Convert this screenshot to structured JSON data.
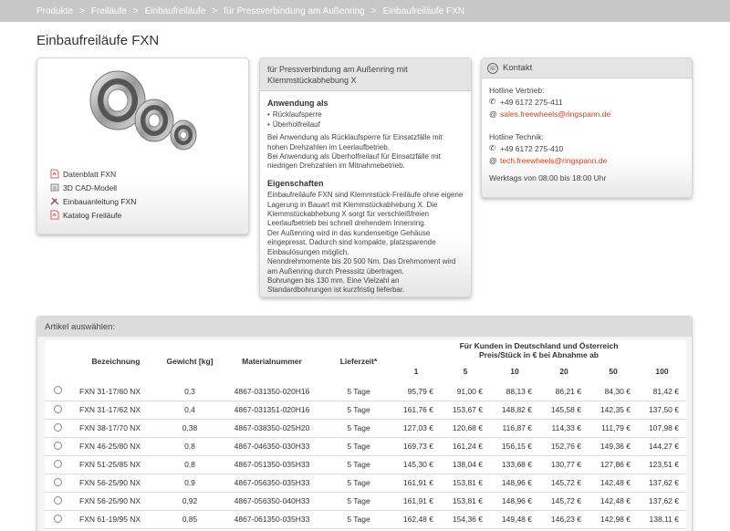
{
  "breadcrumb": [
    "Produkte",
    "Freiläufe",
    "Einbaufreiläufe",
    "für Pressverbindung am Außenring",
    "Einbaufreiläufe FXN"
  ],
  "page_title": "Einbaufreiläufe FXN",
  "downloads": [
    {
      "label": "Datenblatt FXN",
      "icon": "pdf-icon"
    },
    {
      "label": "3D CAD-Modell",
      "icon": "cad-icon"
    },
    {
      "label": "Einbauanleitung FXN",
      "icon": "tools-icon"
    },
    {
      "label": "Katalog Freiläufe",
      "icon": "pdf-icon"
    }
  ],
  "description": {
    "header": "für Pressverbindung am Außenring mit Klemmstückabhebung X",
    "usage_title": "Anwendung als",
    "usage_items": [
      "Rücklaufsperre",
      "Überholfreilauf"
    ],
    "usage_text_1": "Bei Anwendung als Rücklaufsperre für Einsatzfälle mit hohen Drehzahlen im Leerlaufbetrieb.",
    "usage_text_2": "Bei Anwendung als Überholfreilauf für Einsatzfälle mit niedrigen Drehzahlen im Mitnahmebetrieb.",
    "props_title": "Eigenschaften",
    "props_lines": [
      "Einbaufreiläufe FXN sind Klemmstück-Freiläufe ohne eigene Lagerung in Bauart mit Klemmstückabhebung X. Die Klemmstückabhebung X sorgt für verschleißfreien Leerlaufbetrieb bei schnell drehendem Innenring.",
      "Der Außenring wird in das kundenseitige Gehäuse eingepresst. Dadurch sind kompakte, platzsparende Einbaulösungen möglich.",
      "Nenndrehmomente bis 20 500 Nm. Das Drehmoment wird am Außenring durch Presssitz übertragen.",
      "Bohrungen bis 130 mm. Eine Vielzahl an Standardbohrungen ist kurzfristig lieferbar."
    ]
  },
  "contact": {
    "title": "Kontakt",
    "sales_label": "Hotline Vertrieb:",
    "sales_phone": "+49 6172 275-411",
    "sales_mail": "sales.freewheels@ringspann.de",
    "tech_label": "Hotline Technik:",
    "tech_phone": "+49 6172 275-410",
    "tech_mail": "tech.freewheels@ringspann.de",
    "hours": "Werktags von 08:00 bis 18:00 Uhr"
  },
  "table": {
    "section_title": "Artikel auswählen:",
    "col_name": "Bezeichnung",
    "col_weight": "Gewicht [kg]",
    "col_material": "Materialnummer",
    "col_delivery": "Lieferzeit*",
    "price_header_1": "Für Kunden in Deutschland und Österreich",
    "price_header_2": "Preis/Stück in € bei Abnahme ab",
    "quantities": [
      "1",
      "5",
      "10",
      "20",
      "50",
      "100"
    ],
    "rows": [
      {
        "name": "FXN 31-17/60 NX",
        "weight": "0,3",
        "material": "4867-031350-020H16",
        "delivery": "5 Tage",
        "prices": [
          "95,79 €",
          "91,00 €",
          "88,13 €",
          "86,21 €",
          "84,30 €",
          "81,42 €"
        ]
      },
      {
        "name": "FXN 31-17/62 NX",
        "weight": "0,4",
        "material": "4867-031351-020H16",
        "delivery": "5 Tage",
        "prices": [
          "161,76 €",
          "153,67 €",
          "148,82 €",
          "145,58 €",
          "142,35 €",
          "137,50 €"
        ]
      },
      {
        "name": "FXN 38-17/70 NX",
        "weight": "0,38",
        "material": "4867-038350-025H20",
        "delivery": "5 Tage",
        "prices": [
          "127,03 €",
          "120,68 €",
          "116,87 €",
          "114,33 €",
          "111,79 €",
          "107,98 €"
        ]
      },
      {
        "name": "FXN 46-25/80 NX",
        "weight": "0,8",
        "material": "4867-046350-030H33",
        "delivery": "5 Tage",
        "prices": [
          "169,73 €",
          "161,24 €",
          "156,15 €",
          "152,76 €",
          "149,36 €",
          "144,27 €"
        ]
      },
      {
        "name": "FXN 51-25/85 NX",
        "weight": "0,8",
        "material": "4867-051350-035H33",
        "delivery": "5 Tage",
        "prices": [
          "145,30 €",
          "138,04 €",
          "133,68 €",
          "130,77 €",
          "127,86 €",
          "123,51 €"
        ]
      },
      {
        "name": "FXN 56-25/90 NX",
        "weight": "0,9",
        "material": "4867-056350-035H33",
        "delivery": "5 Tage",
        "prices": [
          "161,91 €",
          "153,81 €",
          "148,96 €",
          "145,72 €",
          "142,48 €",
          "137,62 €"
        ]
      },
      {
        "name": "FXN 56-25/90 NX",
        "weight": "0,92",
        "material": "4867-056350-040H33",
        "delivery": "5 Tage",
        "prices": [
          "161,91 €",
          "153,81 €",
          "148,96 €",
          "145,72 €",
          "142,48 €",
          "137,62 €"
        ]
      },
      {
        "name": "FXN 61-19/95 NX",
        "weight": "0,85",
        "material": "4867-061350-035H33",
        "delivery": "5 Tage",
        "prices": [
          "162,48 €",
          "154,36 €",
          "149,48 €",
          "146,23 €",
          "142,98 €",
          "138,11 €"
        ]
      }
    ]
  }
}
